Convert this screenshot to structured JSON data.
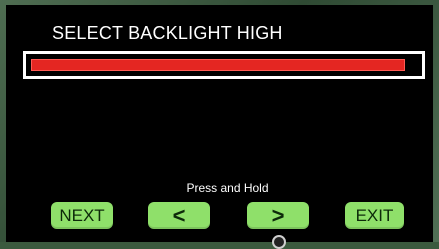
{
  "screen": {
    "title": "SELECT BACKLIGHT HIGH",
    "backlight_level": 0.97,
    "bar_color": "#e42622",
    "hint": "Press and Hold"
  },
  "buttons": {
    "next": "NEXT",
    "decrease": "<",
    "increase": ">",
    "exit": "EXIT",
    "color": "#8fe06a"
  }
}
